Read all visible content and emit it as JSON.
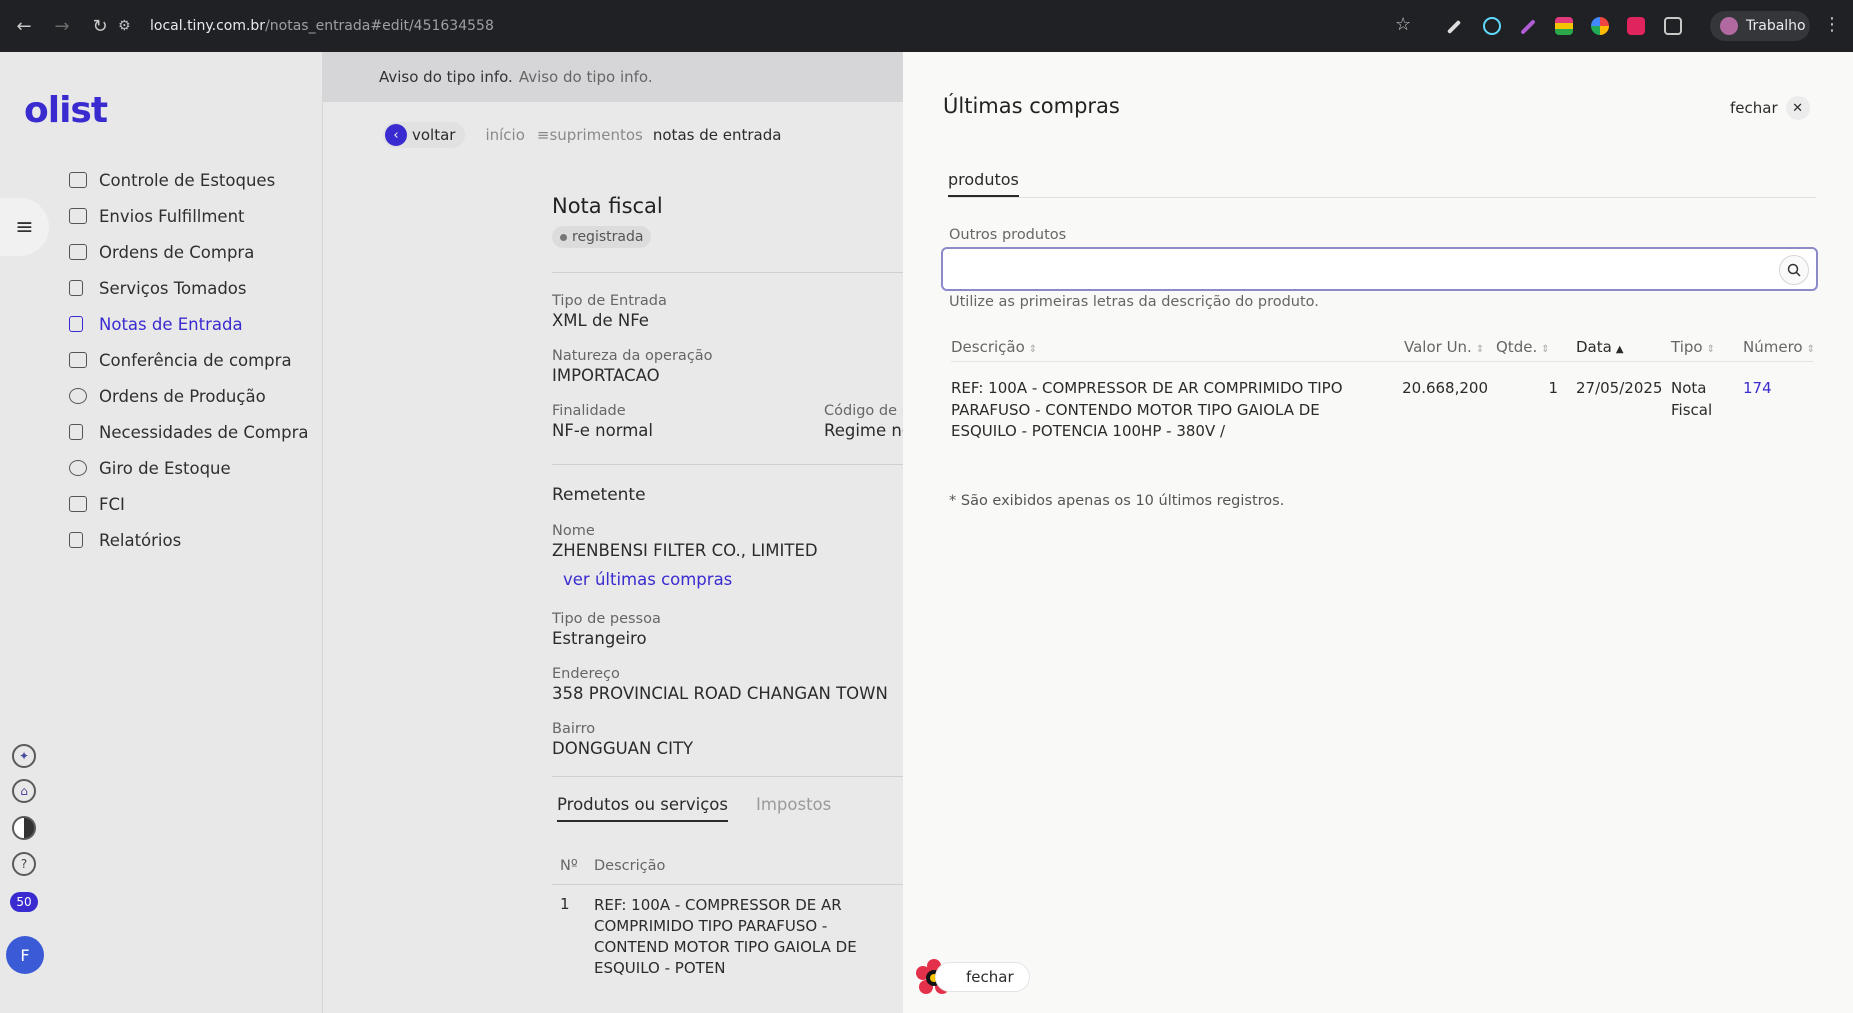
{
  "browser": {
    "url_host": "local.tiny.com.br",
    "url_path": "/notas_entrada#edit/451634558",
    "profile_name": "Trabalho"
  },
  "app": {
    "logo": "olist",
    "badge_count": "50",
    "avatar_initial": "F"
  },
  "sidebar": {
    "items": [
      {
        "label": "Controle de Estoques"
      },
      {
        "label": "Envios Fulfillment"
      },
      {
        "label": "Ordens de Compra"
      },
      {
        "label": "Serviços Tomados"
      },
      {
        "label": "Notas de Entrada"
      },
      {
        "label": "Conferência de compra"
      },
      {
        "label": "Ordens de Produção"
      },
      {
        "label": "Necessidades de Compra"
      },
      {
        "label": "Giro de Estoque"
      },
      {
        "label": "FCI"
      },
      {
        "label": "Relatórios"
      }
    ]
  },
  "alert": {
    "title": "Aviso do tipo info.",
    "text": "Aviso do tipo info."
  },
  "breadcrumb": {
    "back": "voltar",
    "items": [
      "início",
      "≡suprimentos",
      "notas de entrada"
    ]
  },
  "doc": {
    "title": "Nota fiscal",
    "status": "registrada",
    "tipo_entrada_label": "Tipo de Entrada",
    "tipo_entrada_value": "XML de NFe",
    "natureza_label": "Natureza da operação",
    "natureza_value": "IMPORTACAO",
    "finalidade_label": "Finalidade",
    "finalidade_value": "NF-e normal",
    "codigo_label": "Código de r",
    "codigo_value": "Regime no",
    "remetente_title": "Remetente",
    "nome_label": "Nome",
    "nome_value": "ZHENBENSI FILTER CO., LIMITED",
    "ver_ultimas_link": "ver últimas compras",
    "tipo_pessoa_label": "Tipo de pessoa",
    "tipo_pessoa_value": "Estrangeiro",
    "endereco_label": "Endereço",
    "endereco_value": "358 PROVINCIAL ROAD CHANGAN TOWN",
    "bairro_label": "Bairro",
    "bairro_value": "DONGGUAN CITY",
    "tabs": [
      "Produtos ou serviços",
      "Impostos"
    ],
    "table_headers": [
      "Nº",
      "Descrição"
    ],
    "table_rows": [
      {
        "n": "1",
        "desc": "REF: 100A - COMPRESSOR DE AR COMPRIMIDO TIPO PARAFUSO - CONTEND MOTOR TIPO GAIOLA DE ESQUILO - POTEN"
      }
    ]
  },
  "drawer": {
    "title": "Últimas compras",
    "close_label": "fechar",
    "tab": "produtos",
    "search_label": "Outros produtos",
    "search_placeholder": "",
    "hint": "Utilize as primeiras letras da descrição do produto.",
    "headers": {
      "descricao": "Descrição",
      "valor": "Valor Un.",
      "qtde": "Qtde.",
      "data": "Data",
      "tipo": "Tipo",
      "numero": "Número"
    },
    "rows": [
      {
        "descricao": "REF: 100A - COMPRESSOR DE AR COMPRIMIDO TIPO PARAFUSO - CONTENDO MOTOR TIPO GAIOLA DE ESQUILO - POTENCIA 100HP - 380V /",
        "valor": "20.668,200",
        "qtde": "1",
        "data": "27/05/2025",
        "tipo": "Nota Fiscal",
        "numero": "174"
      }
    ],
    "footnote": "* São exibidos apenas os 10 últimos registros."
  },
  "floating": {
    "close_label": "fechar"
  },
  "colors": {
    "brand": "#3a2bd0",
    "chrome": "#202124"
  }
}
